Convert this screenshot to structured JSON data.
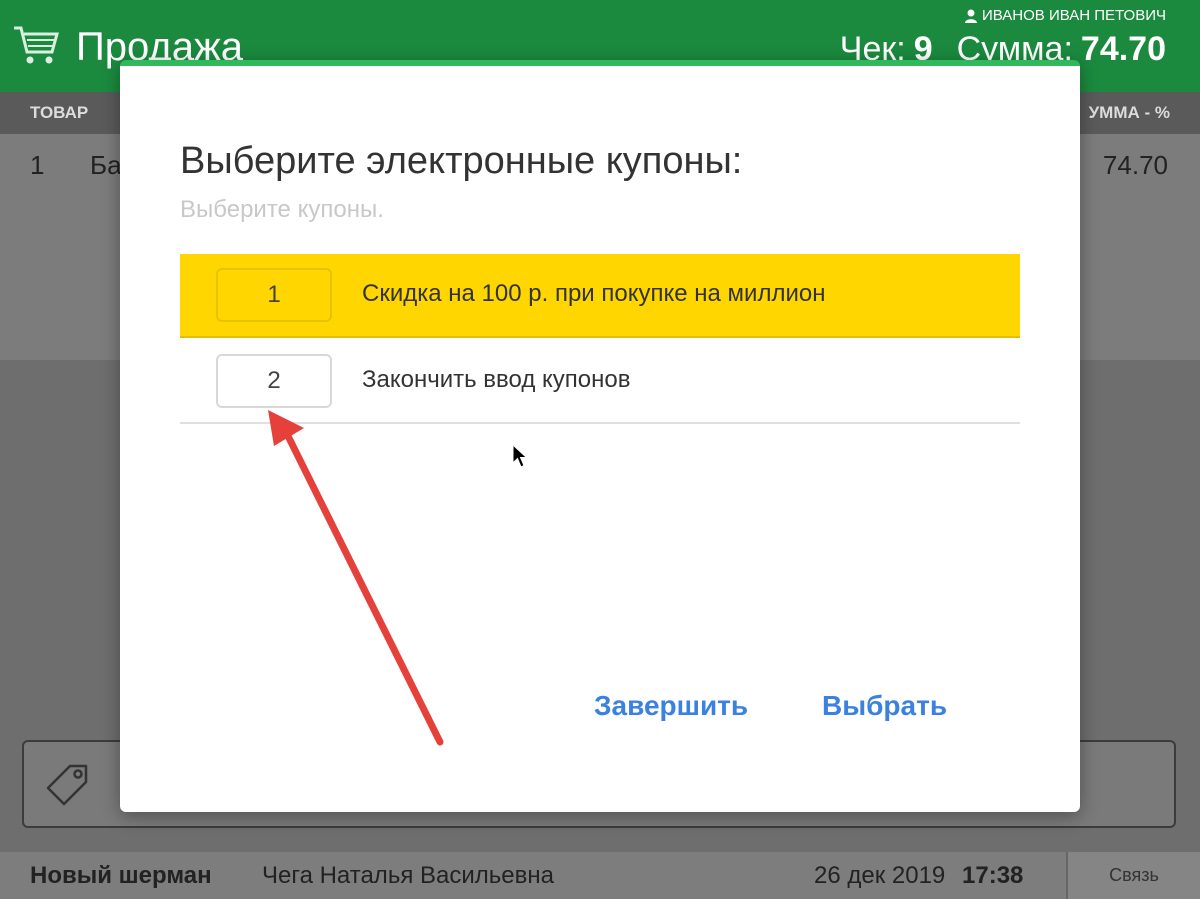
{
  "header": {
    "title": "Продажа",
    "user": "ИВАНОВ ИВАН ПЕТОВИЧ",
    "check_label": "Чек:",
    "check_number": "9",
    "sum_label": "Сумма:",
    "sum_value": "74.70",
    "cart_icon": "shopping-cart-icon",
    "user_icon": "user-icon"
  },
  "table": {
    "col_product": "ТОВАР",
    "col_sum": "УММА - %",
    "rows": [
      {
        "number": "1",
        "name": "Ба",
        "sum": "74.70"
      }
    ]
  },
  "coupon_input": {
    "icon": "tag-icon"
  },
  "footer": {
    "store": "Новый шерман",
    "cashier": "Чега Наталья Васильевна",
    "date": "26 дек 2019",
    "time": "17:38",
    "connection": "Связь"
  },
  "modal": {
    "title": "Выберите электронные купоны:",
    "subtitle": "Выберите купоны.",
    "options": [
      {
        "number": "1",
        "label": "Скидка на 100 р. при покупке на миллион",
        "selected": true
      },
      {
        "number": "2",
        "label": "Закончить ввод купонов",
        "selected": false
      }
    ],
    "finish_button": "Завершить",
    "select_button": "Выбрать"
  },
  "colors": {
    "header_green": "#1b8a3f",
    "selected_yellow": "#ffd600",
    "button_blue": "#3b82e0",
    "annotation_red": "#e5413a"
  }
}
